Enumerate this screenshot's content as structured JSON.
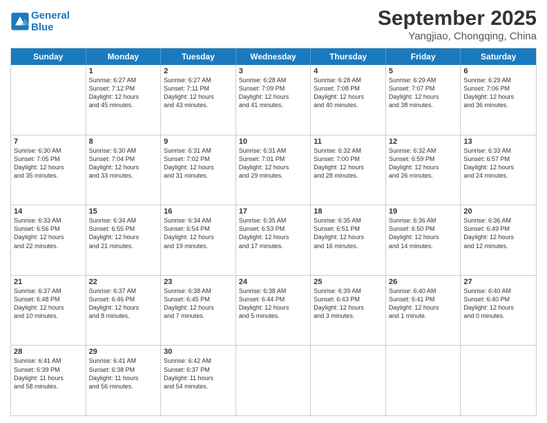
{
  "header": {
    "logo_line1": "General",
    "logo_line2": "Blue",
    "month": "September 2025",
    "location": "Yangjiao, Chongqing, China"
  },
  "days_of_week": [
    "Sunday",
    "Monday",
    "Tuesday",
    "Wednesday",
    "Thursday",
    "Friday",
    "Saturday"
  ],
  "weeks": [
    [
      {
        "day": "",
        "info": ""
      },
      {
        "day": "1",
        "info": "Sunrise: 6:27 AM\nSunset: 7:12 PM\nDaylight: 12 hours\nand 45 minutes."
      },
      {
        "day": "2",
        "info": "Sunrise: 6:27 AM\nSunset: 7:11 PM\nDaylight: 12 hours\nand 43 minutes."
      },
      {
        "day": "3",
        "info": "Sunrise: 6:28 AM\nSunset: 7:09 PM\nDaylight: 12 hours\nand 41 minutes."
      },
      {
        "day": "4",
        "info": "Sunrise: 6:28 AM\nSunset: 7:08 PM\nDaylight: 12 hours\nand 40 minutes."
      },
      {
        "day": "5",
        "info": "Sunrise: 6:29 AM\nSunset: 7:07 PM\nDaylight: 12 hours\nand 38 minutes."
      },
      {
        "day": "6",
        "info": "Sunrise: 6:29 AM\nSunset: 7:06 PM\nDaylight: 12 hours\nand 36 minutes."
      }
    ],
    [
      {
        "day": "7",
        "info": "Sunrise: 6:30 AM\nSunset: 7:05 PM\nDaylight: 12 hours\nand 35 minutes."
      },
      {
        "day": "8",
        "info": "Sunrise: 6:30 AM\nSunset: 7:04 PM\nDaylight: 12 hours\nand 33 minutes."
      },
      {
        "day": "9",
        "info": "Sunrise: 6:31 AM\nSunset: 7:02 PM\nDaylight: 12 hours\nand 31 minutes."
      },
      {
        "day": "10",
        "info": "Sunrise: 6:31 AM\nSunset: 7:01 PM\nDaylight: 12 hours\nand 29 minutes."
      },
      {
        "day": "11",
        "info": "Sunrise: 6:32 AM\nSunset: 7:00 PM\nDaylight: 12 hours\nand 28 minutes."
      },
      {
        "day": "12",
        "info": "Sunrise: 6:32 AM\nSunset: 6:59 PM\nDaylight: 12 hours\nand 26 minutes."
      },
      {
        "day": "13",
        "info": "Sunrise: 6:33 AM\nSunset: 6:57 PM\nDaylight: 12 hours\nand 24 minutes."
      }
    ],
    [
      {
        "day": "14",
        "info": "Sunrise: 6:33 AM\nSunset: 6:56 PM\nDaylight: 12 hours\nand 22 minutes."
      },
      {
        "day": "15",
        "info": "Sunrise: 6:34 AM\nSunset: 6:55 PM\nDaylight: 12 hours\nand 21 minutes."
      },
      {
        "day": "16",
        "info": "Sunrise: 6:34 AM\nSunset: 6:54 PM\nDaylight: 12 hours\nand 19 minutes."
      },
      {
        "day": "17",
        "info": "Sunrise: 6:35 AM\nSunset: 6:53 PM\nDaylight: 12 hours\nand 17 minutes."
      },
      {
        "day": "18",
        "info": "Sunrise: 6:35 AM\nSunset: 6:51 PM\nDaylight: 12 hours\nand 16 minutes."
      },
      {
        "day": "19",
        "info": "Sunrise: 6:36 AM\nSunset: 6:50 PM\nDaylight: 12 hours\nand 14 minutes."
      },
      {
        "day": "20",
        "info": "Sunrise: 6:36 AM\nSunset: 6:49 PM\nDaylight: 12 hours\nand 12 minutes."
      }
    ],
    [
      {
        "day": "21",
        "info": "Sunrise: 6:37 AM\nSunset: 6:48 PM\nDaylight: 12 hours\nand 10 minutes."
      },
      {
        "day": "22",
        "info": "Sunrise: 6:37 AM\nSunset: 6:46 PM\nDaylight: 12 hours\nand 8 minutes."
      },
      {
        "day": "23",
        "info": "Sunrise: 6:38 AM\nSunset: 6:45 PM\nDaylight: 12 hours\nand 7 minutes."
      },
      {
        "day": "24",
        "info": "Sunrise: 6:38 AM\nSunset: 6:44 PM\nDaylight: 12 hours\nand 5 minutes."
      },
      {
        "day": "25",
        "info": "Sunrise: 6:39 AM\nSunset: 6:43 PM\nDaylight: 12 hours\nand 3 minutes."
      },
      {
        "day": "26",
        "info": "Sunrise: 6:40 AM\nSunset: 6:41 PM\nDaylight: 12 hours\nand 1 minute."
      },
      {
        "day": "27",
        "info": "Sunrise: 6:40 AM\nSunset: 6:40 PM\nDaylight: 12 hours\nand 0 minutes."
      }
    ],
    [
      {
        "day": "28",
        "info": "Sunrise: 6:41 AM\nSunset: 6:39 PM\nDaylight: 11 hours\nand 58 minutes."
      },
      {
        "day": "29",
        "info": "Sunrise: 6:41 AM\nSunset: 6:38 PM\nDaylight: 11 hours\nand 56 minutes."
      },
      {
        "day": "30",
        "info": "Sunrise: 6:42 AM\nSunset: 6:37 PM\nDaylight: 11 hours\nand 54 minutes."
      },
      {
        "day": "",
        "info": ""
      },
      {
        "day": "",
        "info": ""
      },
      {
        "day": "",
        "info": ""
      },
      {
        "day": "",
        "info": ""
      }
    ]
  ]
}
